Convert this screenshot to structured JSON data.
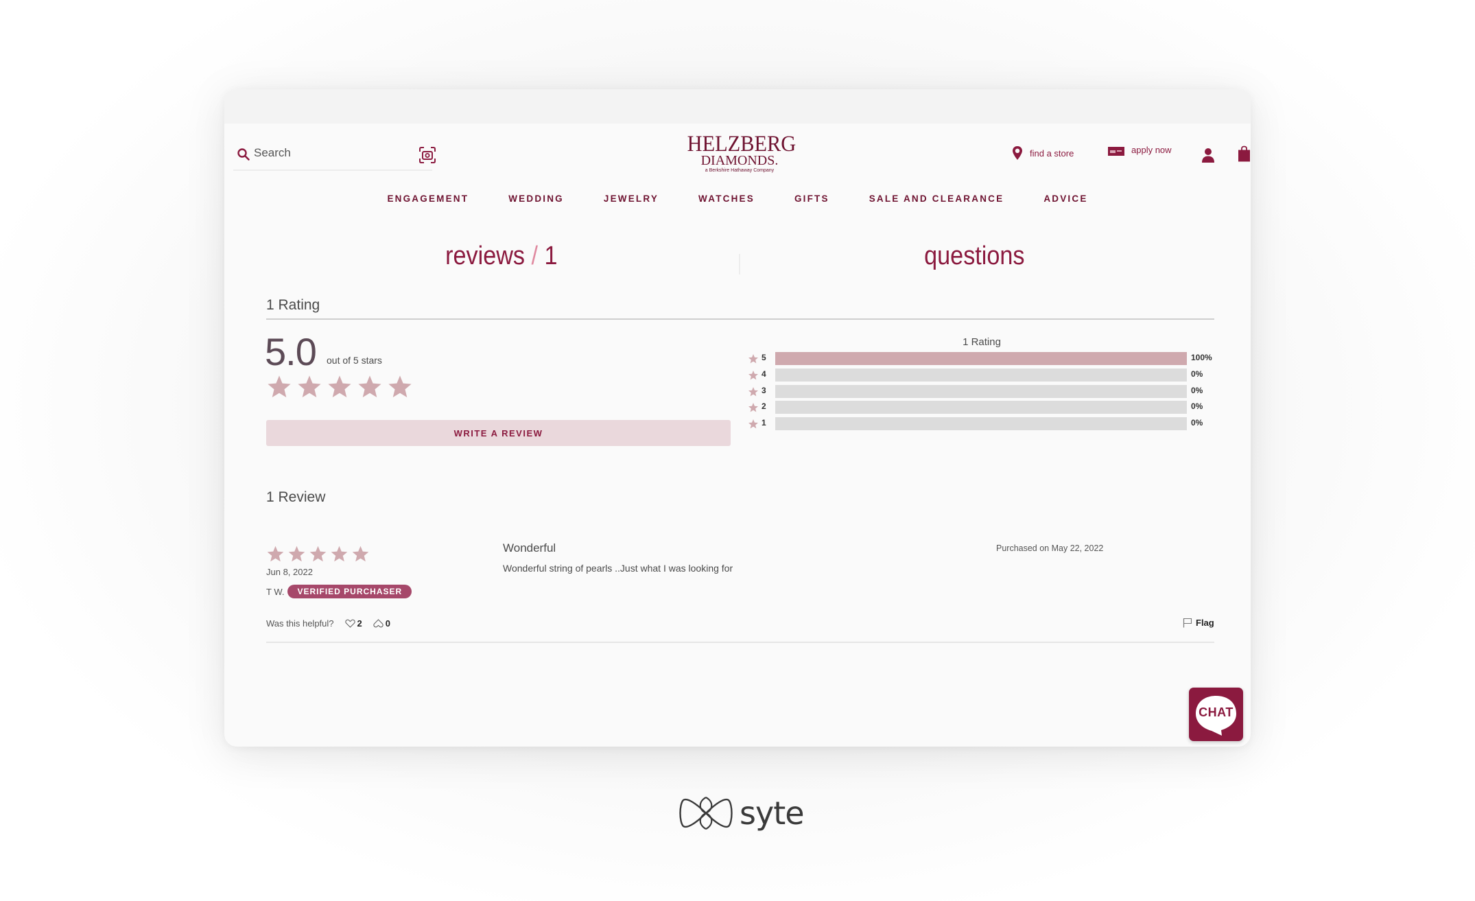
{
  "header": {
    "search_placeholder": "Search",
    "logo": {
      "line1": "HELZBERG",
      "line2": "DIAMONDS.",
      "tagline": "a Berkshire Hathaway Company"
    },
    "find_store": "find a store",
    "apply_now": "apply now",
    "icons": [
      "search-icon",
      "camera-icon",
      "location-pin-icon",
      "credit-card-icon",
      "user-icon",
      "shopping-bag-icon"
    ]
  },
  "nav": [
    "ENGAGEMENT",
    "WEDDING",
    "JEWELRY",
    "WATCHES",
    "GIFTS",
    "SALE AND CLEARANCE",
    "ADVICE"
  ],
  "tabs": {
    "reviews_label": "reviews",
    "reviews_sep": "/",
    "reviews_count": "1",
    "questions_label": "questions"
  },
  "rating_summary": {
    "heading": "1 Rating",
    "score": "5.0",
    "out_of": "out of 5 stars",
    "stars": 5,
    "write_review": "WRITE A REVIEW"
  },
  "histogram": {
    "heading": "1 Rating",
    "rows": [
      {
        "stars": "5",
        "percent": 100,
        "label": "100%"
      },
      {
        "stars": "4",
        "percent": 0,
        "label": "0%"
      },
      {
        "stars": "3",
        "percent": 0,
        "label": "0%"
      },
      {
        "stars": "2",
        "percent": 0,
        "label": "0%"
      },
      {
        "stars": "1",
        "percent": 0,
        "label": "0%"
      }
    ]
  },
  "reviews": {
    "heading": "1 Review",
    "items": [
      {
        "stars": 5,
        "date": "Jun 8, 2022",
        "author": "T W.",
        "badge": "VERIFIED PURCHASER",
        "title": "Wonderful",
        "body": "Wonderful string of pearls ..Just what I was looking for",
        "purchased": "Purchased on May 22, 2022",
        "helpful_label": "Was this helpful?",
        "likes": "2",
        "dislikes": "0",
        "flag_label": "Flag"
      }
    ]
  },
  "chat_label": "CHAT",
  "footer_brand": "syte",
  "colors": {
    "brand": "#8b1a3f",
    "star": "#cfa9ae",
    "badge": "#a6486a",
    "button_bg": "#ead8dc"
  }
}
